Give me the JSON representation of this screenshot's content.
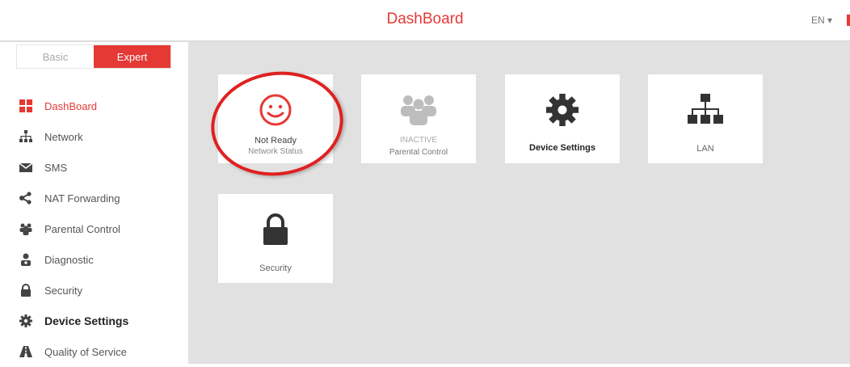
{
  "header": {
    "title": "DashBoard",
    "language": "EN ▾"
  },
  "mode": {
    "basic_label": "Basic",
    "expert_label": "Expert"
  },
  "nav": [
    {
      "label": "DashBoard",
      "icon": "grid-icon"
    },
    {
      "label": "Network",
      "icon": "network-icon"
    },
    {
      "label": "SMS",
      "icon": "envelope-icon"
    },
    {
      "label": "NAT Forwarding",
      "icon": "share-icon"
    },
    {
      "label": "Parental Control",
      "icon": "people-icon"
    },
    {
      "label": "Diagnostic",
      "icon": "diagnostic-icon"
    },
    {
      "label": "Security",
      "icon": "lock-icon"
    },
    {
      "label": "Device Settings",
      "icon": "gear-icon"
    },
    {
      "label": "Quality of Service",
      "icon": "road-icon"
    }
  ],
  "cards": {
    "network": {
      "status": "Not Ready",
      "label": "Network Status"
    },
    "parental": {
      "status": "INACTIVE",
      "label": "Parental Control"
    },
    "device": {
      "label": "Device Settings"
    },
    "lan": {
      "label": "LAN"
    },
    "security": {
      "label": "Security"
    }
  },
  "colors": {
    "accent": "#e53935",
    "annotation": "#e02020",
    "content_bg": "#e1e1e1"
  }
}
